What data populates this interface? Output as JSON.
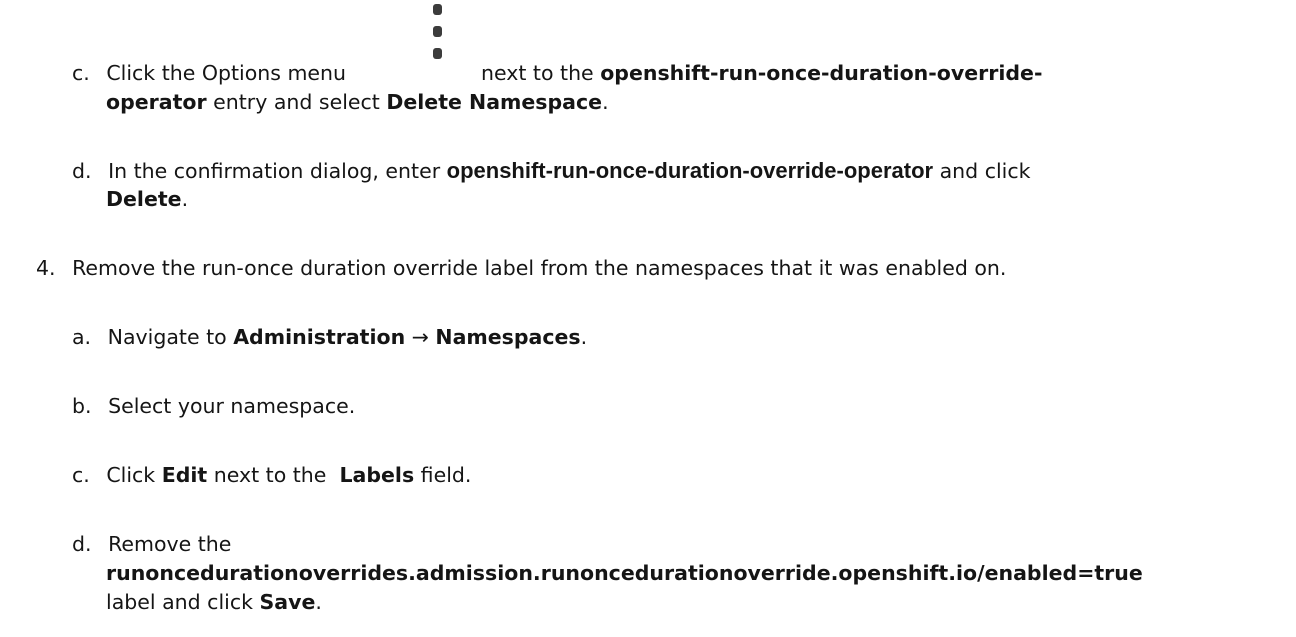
{
  "steps": {
    "c1": {
      "marker": "c.",
      "text1": "Click the Options menu",
      "text2": "next to the ",
      "bold1": "openshift-run-once-duration-override-",
      "bold1b": "operator",
      "text3": " entry and select ",
      "ui1": "Delete Namespace",
      "end": "."
    },
    "d1": {
      "marker": "d.",
      "text1": "In the confirmation dialog, enter ",
      "bold1": "openshift-run-once-duration-override-operator",
      "text2": " and click",
      "ui1": "Delete",
      "end": "."
    },
    "step4": {
      "marker": "4.",
      "text": "Remove the run-once duration override label from the namespaces that it was enabled on."
    },
    "a": {
      "marker": "a.",
      "text1": "Navigate to ",
      "ui1": "Administration",
      "arrow": " → ",
      "ui2": "Namespaces",
      "end": "."
    },
    "b": {
      "marker": "b.",
      "text": "Select your namespace."
    },
    "c2": {
      "marker": "c.",
      "text1": "Click ",
      "ui1": "Edit",
      "text2": " next to the  ",
      "ui2": "Labels",
      "text3": " field."
    },
    "d2": {
      "marker": "d.",
      "text1": "Remove the",
      "ui1": "runoncedurationoverrides.admission.runoncedurationoverride.openshift.io/enabled=true",
      "text2": "label and click ",
      "ui2": "Save",
      "end": "."
    }
  },
  "icons": {
    "options_menu": "kebab-icon"
  }
}
